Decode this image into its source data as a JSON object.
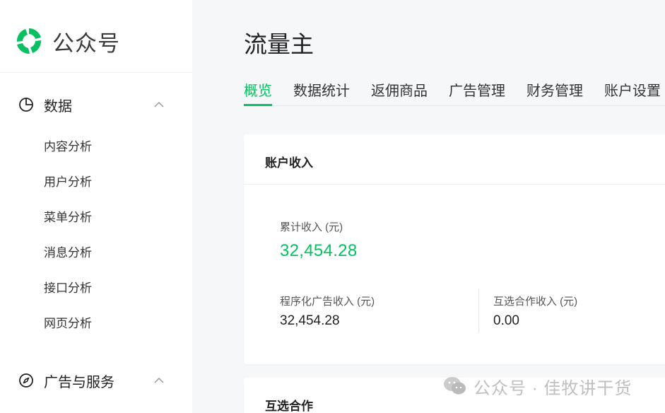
{
  "brand": {
    "name": "公众号"
  },
  "sidebar": {
    "groups": [
      {
        "label": "数据",
        "icon": "pie-chart-icon",
        "expanded": true,
        "items": [
          "内容分析",
          "用户分析",
          "菜单分析",
          "消息分析",
          "接口分析",
          "网页分析"
        ]
      },
      {
        "label": "广告与服务",
        "icon": "compass-icon",
        "expanded": true,
        "items": []
      }
    ]
  },
  "page": {
    "title": "流量主",
    "tabs": [
      "概览",
      "数据统计",
      "返佣商品",
      "广告管理",
      "财务管理",
      "账户设置"
    ],
    "active_tab": "概览"
  },
  "account_income": {
    "title": "账户收入",
    "total_label": "累计收入 (元)",
    "total_value": "32,454.28",
    "programmatic_label": "程序化广告收入 (元)",
    "programmatic_value": "32,454.28",
    "mutual_label": "互选合作收入 (元)",
    "mutual_value": "0.00"
  },
  "mutual_card": {
    "title": "互选合作"
  },
  "watermark": {
    "text": "公众号 · 佳牧讲干货"
  },
  "colors": {
    "accent": "#07c160",
    "background": "#f6f7f9",
    "card": "#ffffff"
  }
}
